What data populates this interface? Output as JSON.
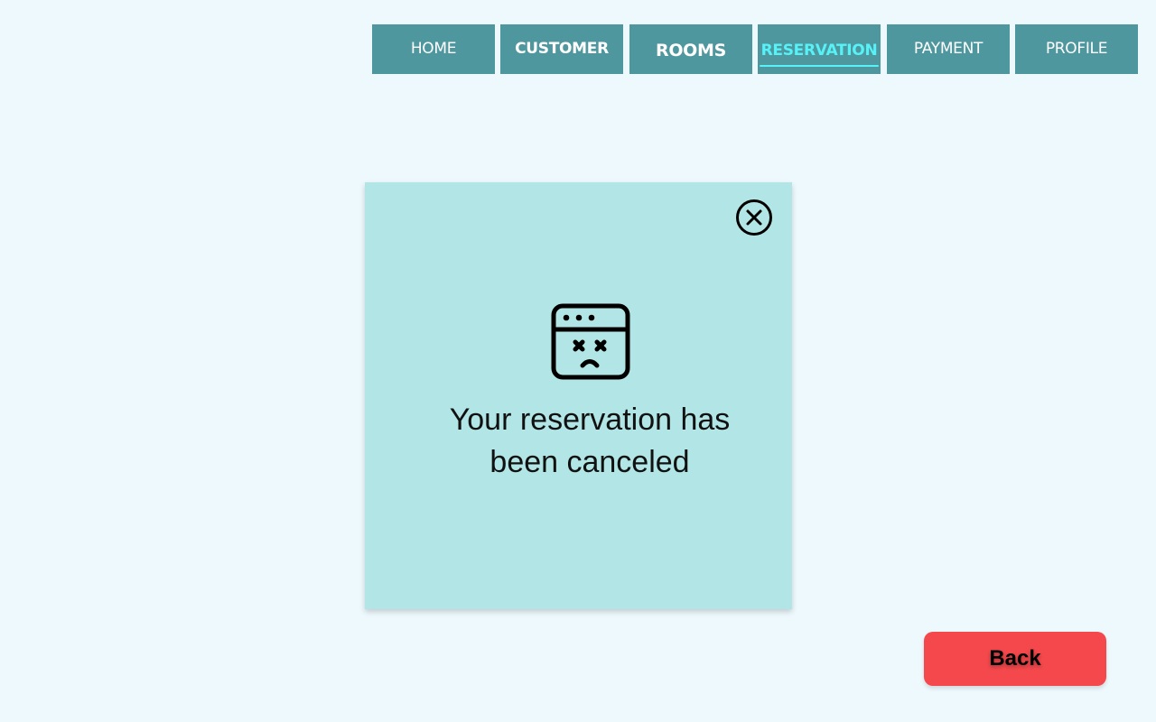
{
  "nav": {
    "tabs": [
      {
        "label": "HOME"
      },
      {
        "label": "CUSTOMER"
      },
      {
        "label": "ROOMS"
      },
      {
        "label": "RESERVATION"
      },
      {
        "label": "PAYMENT"
      },
      {
        "label": "PROFILE"
      }
    ],
    "active_tab": "RESERVATION"
  },
  "dialog": {
    "message_line1": "Your reservation has",
    "message_line2": "been canceled",
    "icon": "browser-error-icon",
    "close_icon": "close-circle-icon"
  },
  "actions": {
    "back_label": "Back"
  },
  "colors": {
    "background": "#eef9fd",
    "nav_tab": "#4f979e",
    "nav_active_text": "#57f2f7",
    "dialog_bg": "#b2e6e6",
    "back_button": "#f4484c"
  }
}
